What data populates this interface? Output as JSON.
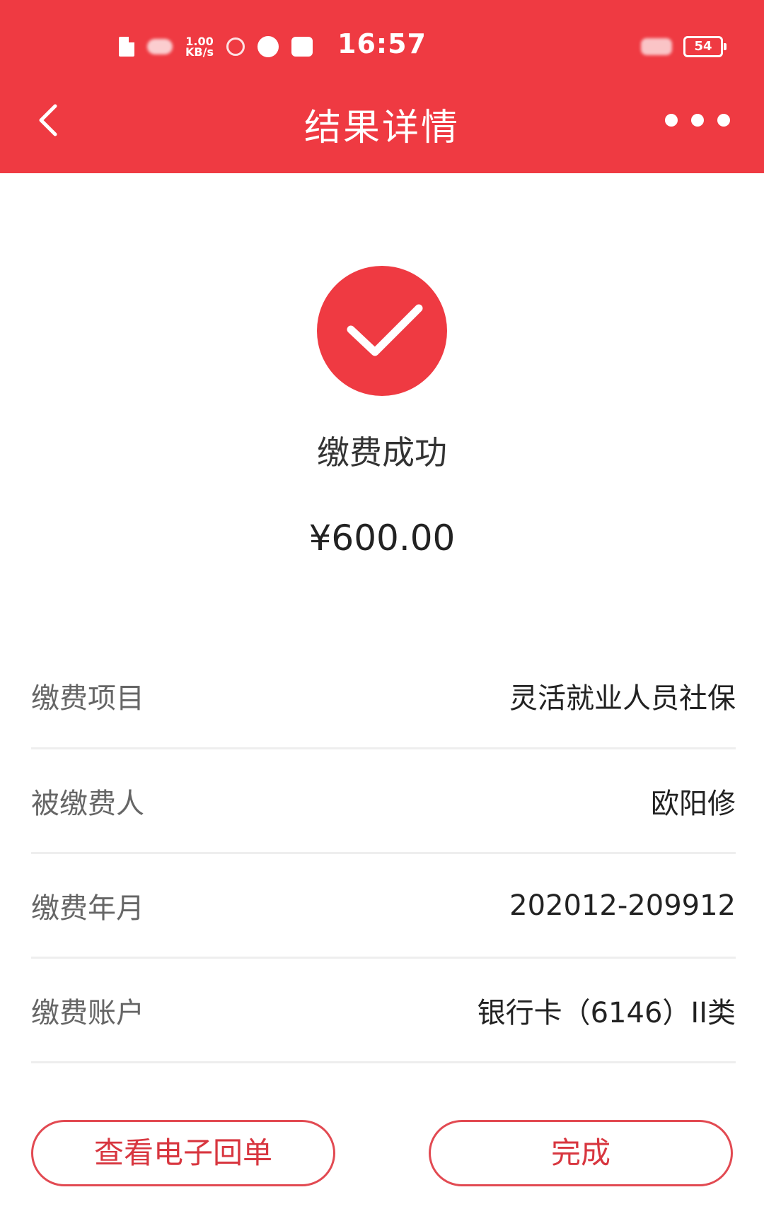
{
  "statusbar": {
    "speed_value": "1.00",
    "speed_unit": "KB/s",
    "time": "16:57",
    "battery": "54"
  },
  "nav": {
    "title": "结果详情",
    "back_icon": "chevron-left-icon",
    "more_icon": "more-dots-icon"
  },
  "result": {
    "status_icon": "check-circle-icon",
    "status_text": "缴费成功",
    "amount": "¥600.00"
  },
  "details": [
    {
      "label": "缴费项目",
      "value": "灵活就业人员社保"
    },
    {
      "label": "被缴费人",
      "value": "欧阳修"
    },
    {
      "label": "缴费年月",
      "value": "202012-209912"
    },
    {
      "label": "缴费账户",
      "value": "银行卡（6146）II类"
    }
  ],
  "actions": {
    "receipt_label": "查看电子回单",
    "done_label": "完成"
  },
  "colors": {
    "brand": "#ef3a42",
    "button_border": "#e24a52"
  }
}
